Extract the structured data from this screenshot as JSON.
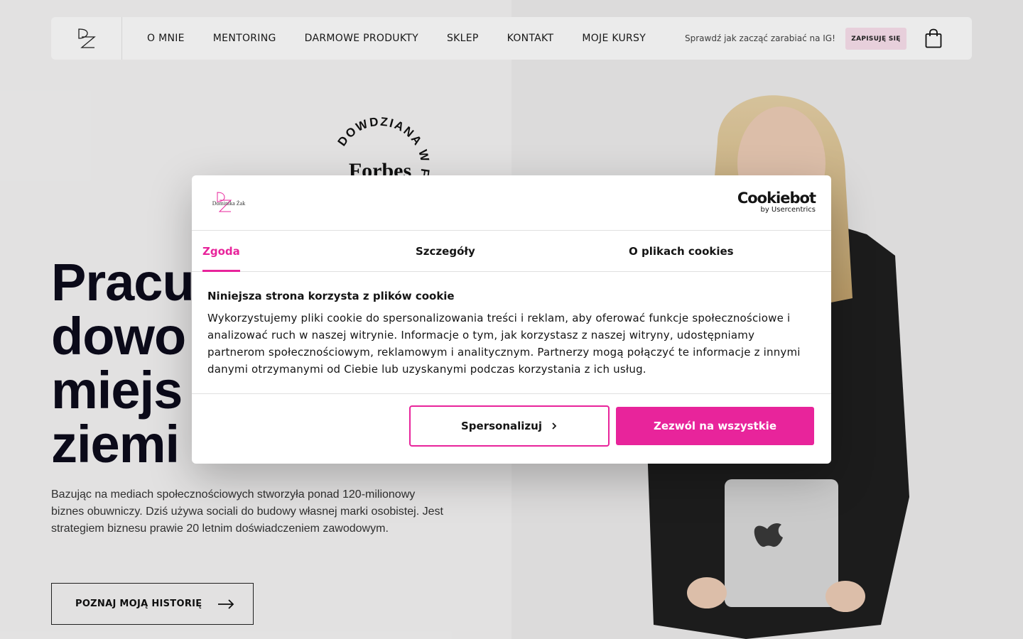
{
  "nav": {
    "items": [
      {
        "label": "O MNIE"
      },
      {
        "label": "MENTORING"
      },
      {
        "label": "DARMOWE PRODUKTY"
      },
      {
        "label": "SKLEP"
      },
      {
        "label": "KONTAKT"
      },
      {
        "label": "MOJE KURSY"
      }
    ],
    "promo_text": "Sprawdź jak zacząć zarabiać na IG!",
    "subscribe_label": "ZAPISUJĘ SIĘ",
    "cart_icon": "shopping-bag-icon"
  },
  "hero": {
    "badge_text": "DOWDZIANA W FORBES",
    "badge_brand": "Forbes",
    "title_lines": [
      "Pracu",
      "dowo",
      "miejs",
      "ziemi"
    ],
    "description": "Bazując na mediach społecznościowych stworzyła ponad 120-milionowy biznes obuwniczy. Dziś używa sociali do budowy własnej marki osobistej. Jest strategiem biznesu prawie 20 letnim doświadczeniem zawodowym.",
    "cta_label": "POZNAJ MOJĄ HISTORIĘ"
  },
  "cookie_dialog": {
    "logo_text": "Dominika Żak",
    "brand": "Cookiebot",
    "brand_sub": "by Usercentrics",
    "tabs": [
      {
        "label": "Zgoda",
        "active": true
      },
      {
        "label": "Szczegóły",
        "active": false
      },
      {
        "label": "O plikach cookies",
        "active": false
      }
    ],
    "heading": "Niniejsza strona korzysta z plików cookie",
    "body": "Wykorzystujemy pliki cookie do spersonalizowania treści i reklam, aby oferować funkcje społecznościowe i analizować ruch w naszej witrynie. Informacje o tym, jak korzystasz z naszej witryny, udostępniamy partnerom społecznościowym, reklamowym i analitycznym. Partnerzy mogą połączyć te informacje z innymi danymi otrzymanymi od Ciebie lub uzyskanymi podczas korzystania z ich usług.",
    "customize_label": "Spersonalizuj",
    "allow_label": "Zezwól na wszystkie"
  },
  "colors": {
    "accent": "#e8249b",
    "title_dark": "#0d0b1c",
    "subscribe_bg": "#fbe1ee"
  }
}
